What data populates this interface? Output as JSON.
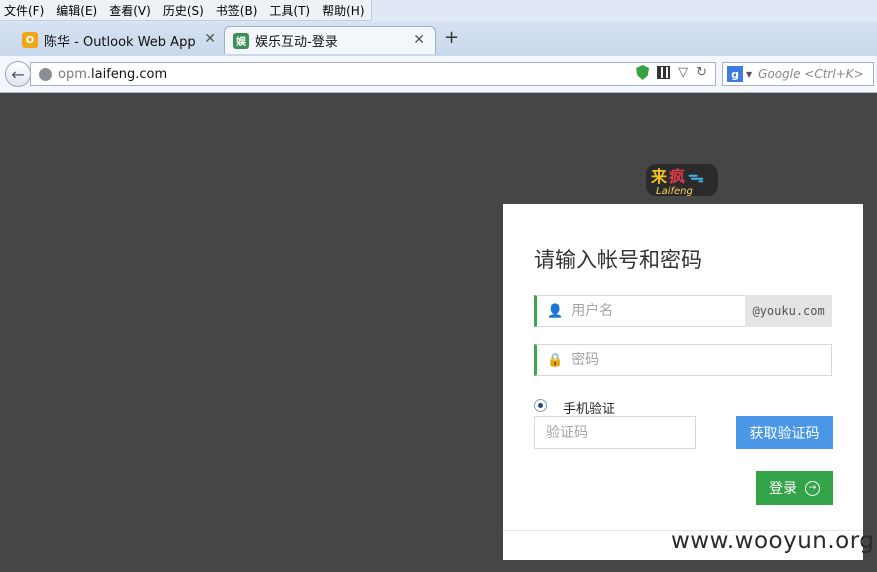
{
  "menubar": {
    "items": [
      "文件(F)",
      "编辑(E)",
      "查看(V)",
      "历史(S)",
      "书签(B)",
      "工具(T)",
      "帮助(H)"
    ]
  },
  "tabs": [
    {
      "title": "陈华 - Outlook Web App",
      "icon": "outlook-icon",
      "active": false
    },
    {
      "title": "娱乐互动-登录",
      "icon": "site-favicon",
      "active": true
    }
  ],
  "navbar": {
    "url_prefix": "opm.",
    "url_domain": "laifeng.com",
    "search_placeholder": "Google <Ctrl+K>"
  },
  "login": {
    "logo_text": "Laifeng",
    "heading": "请输入帐号和密码",
    "username_placeholder": "用户名",
    "username_suffix": "@youku.com",
    "password_placeholder": "密码",
    "radio_label": "手机验证",
    "code_placeholder": "验证码",
    "get_code_label": "获取验证码",
    "login_label": "登录"
  },
  "watermark": "www.wooyun.org",
  "colors": {
    "page_bg": "#464646",
    "accent_green": "#35a34a",
    "accent_blue": "#4a97e8"
  }
}
